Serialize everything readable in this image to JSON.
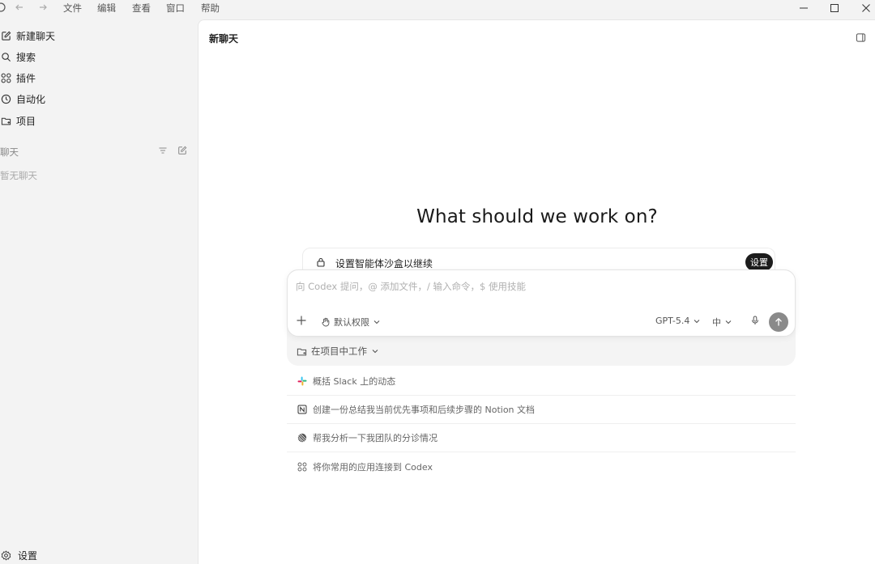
{
  "titlebar": {
    "menu": [
      "文件",
      "编辑",
      "查看",
      "窗口",
      "帮助"
    ],
    "icons": [
      "app-icon",
      "back-arrow-icon",
      "forward-arrow-icon",
      "minimize-icon",
      "maximize-icon",
      "close-icon"
    ]
  },
  "sidebar": {
    "items": [
      {
        "label": "新建聊天",
        "icon": "compose-icon"
      },
      {
        "label": "搜索",
        "icon": "search-icon"
      },
      {
        "label": "插件",
        "icon": "plugins-icon"
      },
      {
        "label": "自动化",
        "icon": "clock-icon"
      },
      {
        "label": "项目",
        "icon": "folder-icon"
      }
    ],
    "section_label": "聊天",
    "empty_text": "暂无聊天",
    "settings_label": "设置"
  },
  "main": {
    "title": "新聊天",
    "hero": "What should we work on?",
    "sandbox": {
      "text": "设置智能体沙盒以继续",
      "button": "设置"
    },
    "composer": {
      "placeholder": "向 Codex 提问，@ 添加文件，/ 输入命令，$ 使用技能",
      "permission": "默认权限",
      "model": "GPT-5.4",
      "effort": "中"
    },
    "project_label": "在项目中工作",
    "suggestions": [
      {
        "text": "概括 Slack 上的动态",
        "icon": "slack-icon"
      },
      {
        "text": "创建一份总结我当前优先事项和后续步骤的 Notion 文档",
        "icon": "notion-icon"
      },
      {
        "text": "帮我分析一下我团队的分诊情况",
        "icon": "linear-icon"
      },
      {
        "text": "将你常用的应用连接到 Codex",
        "icon": "apps-icon"
      }
    ]
  }
}
